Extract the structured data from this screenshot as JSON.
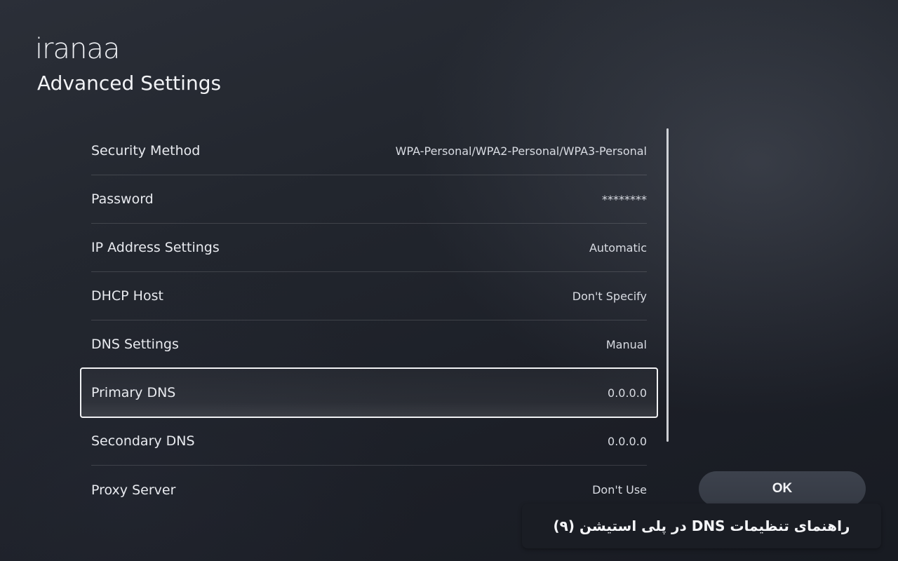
{
  "brand": {
    "logo_text": "iranaa"
  },
  "header": {
    "title": "Advanced Settings"
  },
  "settings": [
    {
      "label": "Security Method",
      "value": "WPA-Personal/WPA2-Personal/WPA3-Personal"
    },
    {
      "label": "Password",
      "value": "********"
    },
    {
      "label": "IP Address Settings",
      "value": "Automatic"
    },
    {
      "label": "DHCP Host",
      "value": "Don't Specify"
    },
    {
      "label": "DNS Settings",
      "value": "Manual"
    },
    {
      "label": "Primary DNS",
      "value": "0.0.0.0"
    },
    {
      "label": "Secondary DNS",
      "value": "0.0.0.0"
    },
    {
      "label": "Proxy Server",
      "value": "Don't Use"
    }
  ],
  "selected_item": "Primary DNS",
  "actions": {
    "ok_label": "OK"
  },
  "caption": {
    "text": "راهنمای تنظیمات DNS در پلی استیشن (۹)"
  },
  "colors": {
    "background": "#22262e",
    "text": "#e8eaef",
    "selection_border": "#f1f2f4",
    "button_bg": "#3a3f4a",
    "caption_bg": "#1a1d24"
  }
}
